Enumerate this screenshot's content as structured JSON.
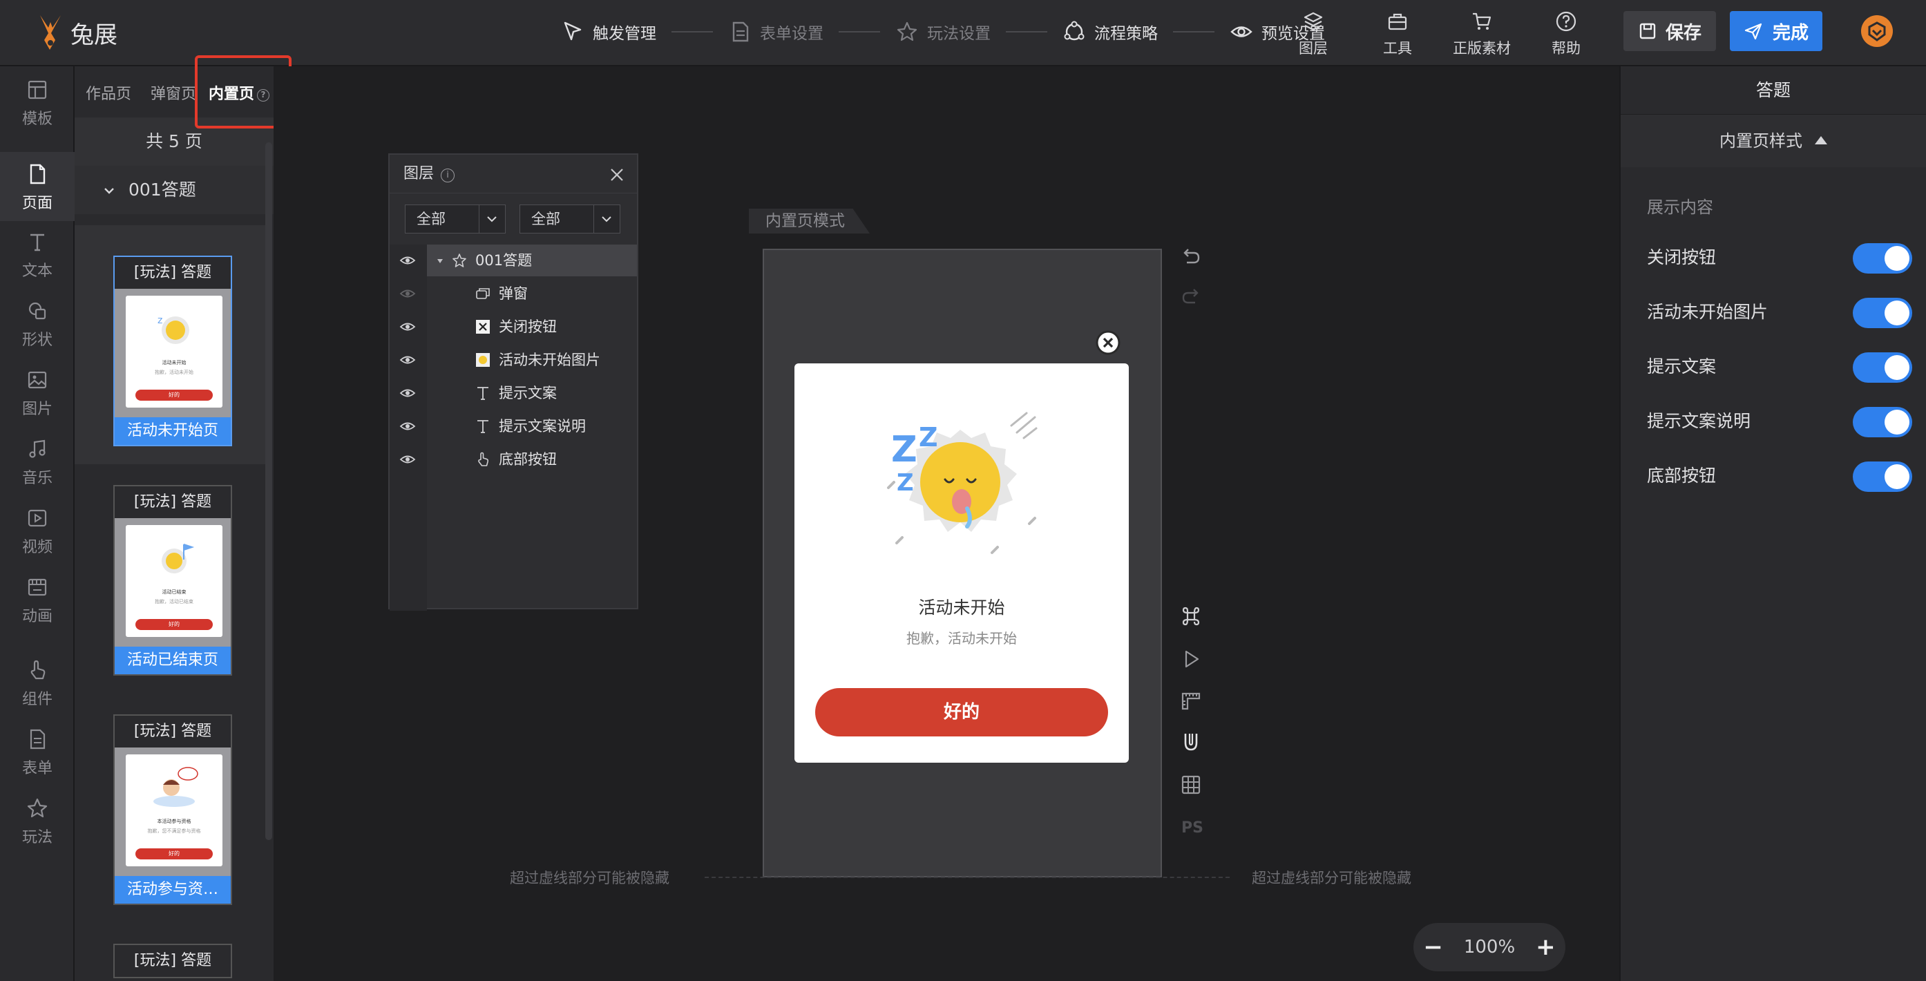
{
  "app": {
    "name": "兔展",
    "brand_color": "#e8822c"
  },
  "steps": [
    {
      "label": "触发管理",
      "icon": "cursor-icon",
      "active": true
    },
    {
      "label": "表单设置",
      "icon": "form-icon",
      "active": false
    },
    {
      "label": "玩法设置",
      "icon": "star-icon",
      "active": false
    },
    {
      "label": "流程策略",
      "icon": "flow-icon",
      "active": true
    },
    {
      "label": "预览设置",
      "icon": "eye-icon",
      "active": true
    }
  ],
  "tools": [
    {
      "label": "图层",
      "icon": "layers-icon"
    },
    {
      "label": "工具",
      "icon": "toolbox-icon"
    },
    {
      "label": "正版素材",
      "icon": "cart-icon"
    },
    {
      "label": "帮助",
      "icon": "help-icon"
    }
  ],
  "actions": {
    "save": "保存",
    "done": "完成",
    "accent": "#2c7be5"
  },
  "leftnav": [
    {
      "label": "模板",
      "icon": "template-icon"
    },
    {
      "label": "页面",
      "icon": "page-icon",
      "active": true
    },
    {
      "label": "文本",
      "icon": "text-icon"
    },
    {
      "label": "形状",
      "icon": "shape-icon"
    },
    {
      "label": "图片",
      "icon": "image-icon"
    },
    {
      "label": "音乐",
      "icon": "music-icon"
    },
    {
      "label": "视频",
      "icon": "video-icon"
    },
    {
      "label": "动画",
      "icon": "animation-icon"
    },
    {
      "label": "组件",
      "icon": "pointer-icon"
    },
    {
      "label": "表单",
      "icon": "form-icon"
    },
    {
      "label": "玩法",
      "icon": "star-icon"
    }
  ],
  "pages": {
    "tabs": [
      "作品页",
      "弹窗页",
      "内置页"
    ],
    "active_tab": "内置页",
    "count": "共 5 页",
    "group": "001答题",
    "thumbs": [
      {
        "header": "[玩法] 答题",
        "footer": "活动未开始页",
        "card_title": "活动未开始",
        "card_sub": "抱歉，活动未开始",
        "card_btn": "好的"
      },
      {
        "header": "[玩法] 答题",
        "footer": "活动已结束页",
        "card_title": "活动已结束",
        "card_sub": "抱歉，活动已结束",
        "card_btn": "好的"
      },
      {
        "header": "[玩法] 答题",
        "footer": "活动参与资…",
        "card_title": "本活动参与资格",
        "card_sub": "抱歉，您不满足参与资格",
        "card_btn": "好的"
      },
      {
        "header": "[玩法] 答题"
      }
    ]
  },
  "layers_panel": {
    "title": "图层",
    "filter1": "全部",
    "filter2": "全部",
    "rows": [
      {
        "label": "001答题",
        "icon": "star-icon",
        "eye": "visible",
        "active": true
      },
      {
        "label": "弹窗",
        "icon": "popup-icon",
        "eye": "dim"
      },
      {
        "label": "关闭按钮",
        "icon": "close-image-icon",
        "eye": "visible"
      },
      {
        "label": "活动未开始图片",
        "icon": "image-thumb-icon",
        "eye": "visible"
      },
      {
        "label": "提示文案",
        "icon": "text-icon",
        "eye": "visible"
      },
      {
        "label": "提示文案说明",
        "icon": "text-icon",
        "eye": "visible"
      },
      {
        "label": "底部按钮",
        "icon": "pointer-icon",
        "eye": "visible"
      }
    ]
  },
  "canvas": {
    "mode_label": "内置页模式",
    "hint_left": "超过虚线部分可能被隐藏",
    "hint_right": "超过虚线部分可能被隐藏",
    "zoom": "100%",
    "ps_label": "PS"
  },
  "modal": {
    "title": "活动未开始",
    "subtitle": "抱歉，活动未开始",
    "button": "好的",
    "button_color": "#d13f2e"
  },
  "rightpanel": {
    "title": "答题",
    "section": "内置页样式",
    "group": "展示内容",
    "toggles": [
      {
        "label": "关闭按钮",
        "on": true
      },
      {
        "label": "活动未开始图片",
        "on": true
      },
      {
        "label": "提示文案",
        "on": true
      },
      {
        "label": "提示文案说明",
        "on": true
      },
      {
        "label": "底部按钮",
        "on": true
      }
    ],
    "toggle_color": "#2f80ed"
  }
}
